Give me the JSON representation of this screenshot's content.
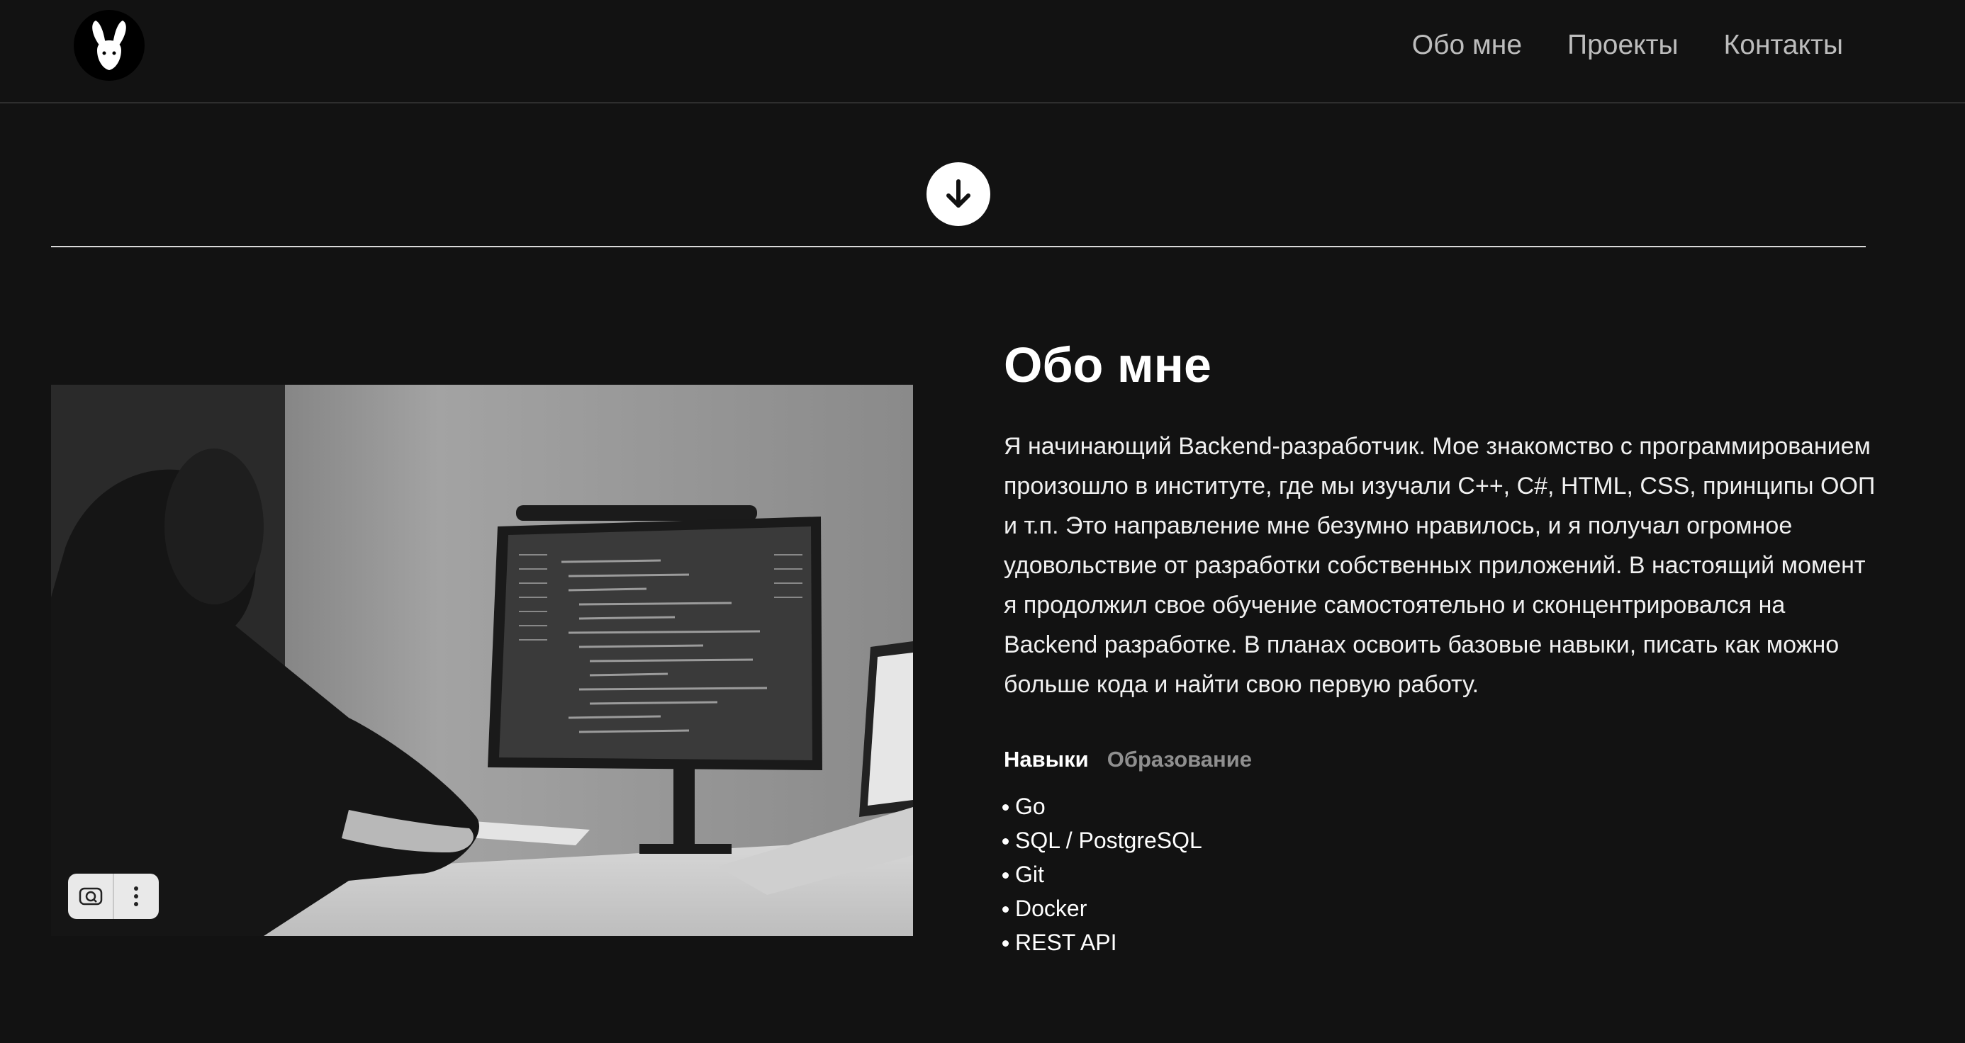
{
  "header": {
    "logo_alt": "rabbit-logo",
    "nav": [
      {
        "label": "Обо мне"
      },
      {
        "label": "Проекты"
      },
      {
        "label": "Контакты"
      }
    ]
  },
  "scroll": {
    "icon": "arrow-down-icon"
  },
  "about": {
    "title": "Обо мне",
    "bio": "Я начинающий Backend-разработчик. Мое знакомство с программированием произошло в институте, где мы изучали C++, C#, HTML, CSS, принципы ООП и т.п. Это направление мне безумно нравилось, и я получал огромное удовольствие от разработки собственных приложений. В настоящий момент я продолжил свое обучение самостоятельно и сконцентрировался на Backend разработке. В планах освоить базовые навыки, писать как можно больше кода и найти свою первую работу.",
    "tabs": [
      {
        "label": "Навыки",
        "active": true
      },
      {
        "label": "Образование",
        "active": false
      }
    ],
    "skills": [
      "Go",
      "SQL / PostgreSQL",
      "Git",
      "Docker",
      "REST API"
    ]
  },
  "photo": {
    "tool_icons": [
      "lens-search-icon",
      "more-vertical-icon"
    ]
  },
  "colors": {
    "background": "#121212",
    "text": "#ffffff",
    "nav_text": "#bdbdbd",
    "inactive_tab": "#8f8f8f"
  }
}
